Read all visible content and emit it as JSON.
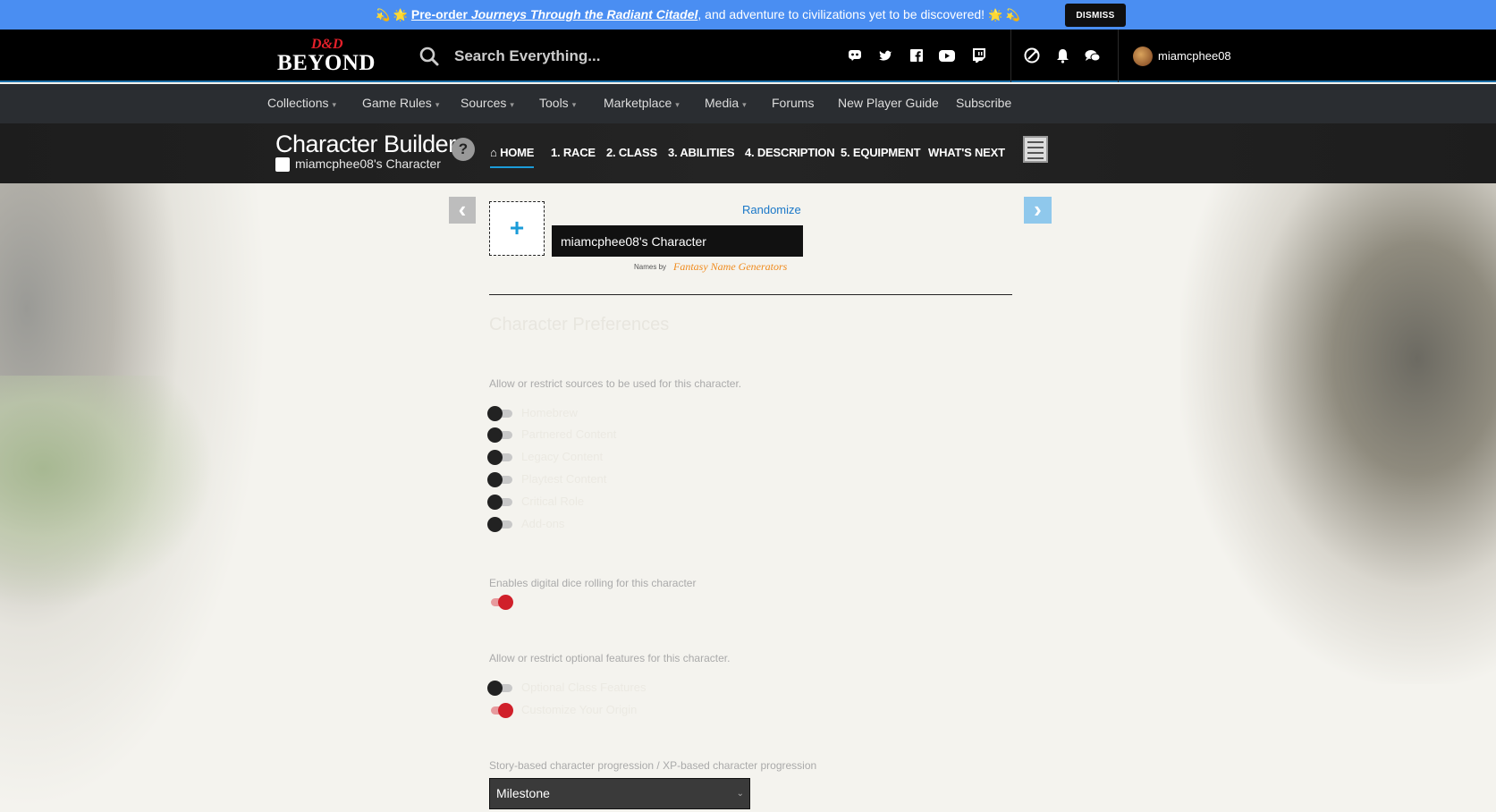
{
  "promo": {
    "emoji_left": "💫 🌟",
    "link_text": "Pre-order ",
    "link_italic": "Journeys Through the Radiant Citadel",
    "rest": ", and adventure to civilizations yet to be discovered!",
    "emoji_right": "🌟 💫",
    "dismiss_label": "DISMISS"
  },
  "header": {
    "logo_top": "D&D",
    "logo_bottom": "BEYOND",
    "search_placeholder": "Search Everything...",
    "social_icons": [
      "discord-icon",
      "twitter-icon",
      "facebook-icon",
      "youtube-icon",
      "twitch-icon"
    ],
    "username": "miamcphee08"
  },
  "mainnav": {
    "items": [
      {
        "label": "Collections",
        "caret": true
      },
      {
        "label": "Game Rules",
        "caret": true
      },
      {
        "label": "Sources",
        "caret": true
      },
      {
        "label": "Tools",
        "caret": true
      },
      {
        "label": "Marketplace",
        "caret": true
      },
      {
        "label": "Media",
        "caret": true
      },
      {
        "label": "Forums",
        "caret": false
      },
      {
        "label": "New Player Guide",
        "caret": false
      },
      {
        "label": "Subscribe",
        "caret": false
      }
    ],
    "caret_glyph": "▾"
  },
  "builder": {
    "title": "Character Builder",
    "character_name": "miamcphee08's Character",
    "help_glyph": "?",
    "steps": [
      "HOME",
      "1. RACE",
      "2. CLASS",
      "3. ABILITIES",
      "4. DESCRIPTION",
      "5. EQUIPMENT",
      "WHAT'S NEXT"
    ],
    "home_glyph": "⌂"
  },
  "home": {
    "randomize_label": "Randomize",
    "name_value": "miamcphee08's Character",
    "names_by": "Names by",
    "names_provider": "Fantasy Name Generators",
    "section_title": "Character Preferences",
    "sources_desc": "Allow or restrict sources to be used for this character.",
    "source_toggles": [
      {
        "label": "Homebrew",
        "on": false
      },
      {
        "label": "Partnered Content",
        "on": false
      },
      {
        "label": "Legacy Content",
        "on": false
      },
      {
        "label": "Playtest Content",
        "on": false
      },
      {
        "label": "Critical Role",
        "on": false
      },
      {
        "label": "Add-ons",
        "on": false
      }
    ],
    "dice_desc": "Enables digital dice rolling for this character",
    "dice_toggle_on": true,
    "optional_desc": "Allow or restrict optional features for this character.",
    "optional_toggles": [
      {
        "label": "Optional Class Features",
        "on": false
      },
      {
        "label": "Customize Your Origin",
        "on": true
      }
    ],
    "progression_desc": "Story-based character progression / XP-based character progression",
    "progression_value": "Milestone",
    "select_chevron": "⌄"
  },
  "colors": {
    "promo_bg": "#4a8ef2",
    "header_bg": "#000000",
    "nav_bg": "#2a2d31",
    "accent_blue": "#1b9cd8",
    "toggle_on": "#d0202a"
  }
}
